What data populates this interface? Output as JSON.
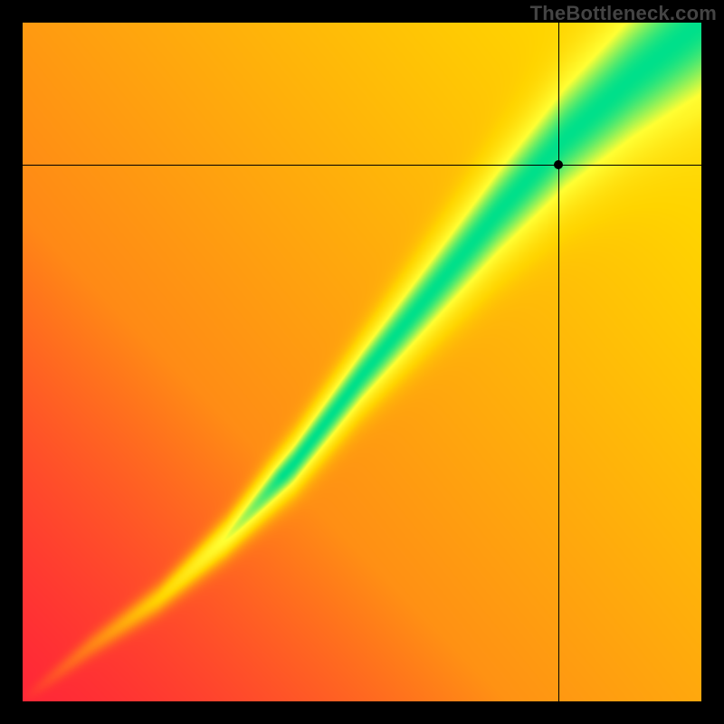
{
  "watermark": "TheBottleneck.com",
  "chart_data": {
    "type": "heatmap",
    "title": "",
    "xlabel": "",
    "ylabel": "",
    "xlim": [
      0,
      1
    ],
    "ylim": [
      0,
      1
    ],
    "grid": false,
    "legend": false,
    "color_scale": [
      "#ff1f3a",
      "#ff7a1a",
      "#ffd400",
      "#ffff33",
      "#00e08a"
    ],
    "ridge": [
      {
        "x": 0.0,
        "y": 0.0,
        "half_width": 0.008
      },
      {
        "x": 0.1,
        "y": 0.08,
        "half_width": 0.012
      },
      {
        "x": 0.2,
        "y": 0.15,
        "half_width": 0.015
      },
      {
        "x": 0.3,
        "y": 0.24,
        "half_width": 0.02
      },
      {
        "x": 0.4,
        "y": 0.35,
        "half_width": 0.028
      },
      {
        "x": 0.5,
        "y": 0.48,
        "half_width": 0.035
      },
      {
        "x": 0.6,
        "y": 0.6,
        "half_width": 0.045
      },
      {
        "x": 0.7,
        "y": 0.72,
        "half_width": 0.055
      },
      {
        "x": 0.8,
        "y": 0.83,
        "half_width": 0.065
      },
      {
        "x": 0.9,
        "y": 0.92,
        "half_width": 0.075
      },
      {
        "x": 1.0,
        "y": 1.0,
        "half_width": 0.085
      }
    ],
    "marker": {
      "x": 0.79,
      "y": 0.79
    },
    "crosshair": {
      "x": 0.79,
      "y": 0.79
    },
    "description": "Compatibility-score heatmap. Curved green ridge marks high scores; colors fall off through yellow/orange to red away from it. Crosshair and dot mark the user's configuration.",
    "side_lobe": {
      "offset": 0.11,
      "half_width": 0.035,
      "strength": 0.45
    }
  }
}
